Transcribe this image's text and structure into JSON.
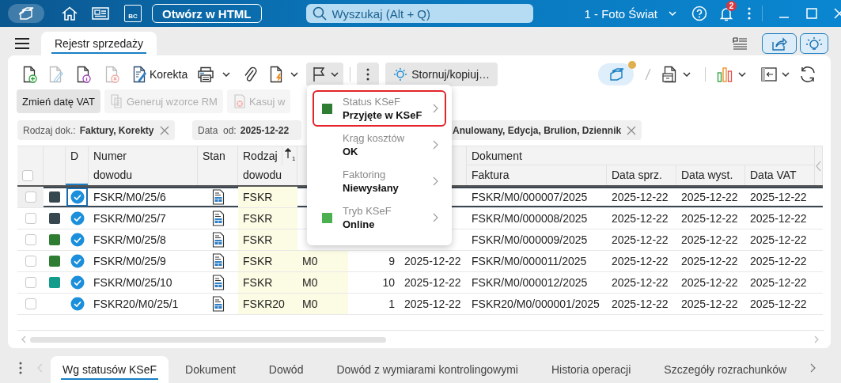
{
  "titlebar": {
    "html_button": "Otwórz w HTML",
    "bc_label": "BC",
    "search": {
      "placeholder": "Wyszukaj (Alt + Q)"
    },
    "company": "1 - Foto Świat",
    "notifications": "2"
  },
  "tabs": [
    {
      "label": "Rejestr sprzedaży",
      "selected": true
    }
  ],
  "toolbar": {
    "correction": "Korekta",
    "flag_menu_open": true,
    "storno": "Stornuj/kopiuj…",
    "sync_pending": true
  },
  "actions": [
    {
      "label": "Zmień datę VAT",
      "disabled": false
    },
    {
      "label": "Generuj wzorce RM",
      "disabled": true
    },
    {
      "label": "Kasuj w",
      "disabled": true
    }
  ],
  "filters": [
    {
      "label": "Rodzaj dok.:",
      "value": "Faktury, Korekty"
    },
    {
      "label": "Data  od:",
      "value": "2025-12-22"
    },
    {
      "value": "Anulowany, Edycja, Brulion, Dziennik"
    }
  ],
  "table": {
    "all_checked": false,
    "header": {
      "d": "D",
      "number": "Numer dowodu",
      "status": "Stan",
      "doc_type": "Rodzaj dowodu",
      "sort_order": "1",
      "group": "Dokument",
      "invoice": "Faktura",
      "sale_date": "Data sprz.",
      "issue_date": "Data wyst.",
      "vat_date": "Data VAT"
    },
    "rows": [
      {
        "checked": false,
        "selected": true,
        "color": "#37474f",
        "confirmed": true,
        "number": "FSKR/M0/25/6",
        "doc_type": "FSKR",
        "invoice": "FSKR/M0/000007/2025",
        "sale_date": "2025-12-22",
        "issue_date": "2025-12-22",
        "vat_date": "2025-12-22"
      },
      {
        "checked": false,
        "selected": false,
        "color": "#37474f",
        "confirmed": true,
        "number": "FSKR/M0/25/7",
        "doc_type": "FSKR",
        "invoice": "FSKR/M0/000008/2025",
        "sale_date": "2025-12-22",
        "issue_date": "2025-12-22",
        "vat_date": "2025-12-22"
      },
      {
        "checked": false,
        "selected": false,
        "color": "#2e7d32",
        "confirmed": true,
        "number": "FSKR/M0/25/8",
        "doc_type": "FSKR",
        "invoice": "FSKR/M0/000009/2025",
        "sale_date": "2025-12-22",
        "issue_date": "2025-12-22",
        "vat_date": "2025-12-22"
      },
      {
        "checked": false,
        "selected": false,
        "color": "#2e7d32",
        "confirmed": true,
        "number": "FSKR/M0/25/9",
        "doc_type": "FSKR",
        "warehouse": "M0",
        "nr": "9",
        "date": "2025-12-22",
        "invoice": "FSKR/M0/000011/2025",
        "sale_date": "2025-12-22",
        "issue_date": "2025-12-22",
        "vat_date": "2025-12-22"
      },
      {
        "checked": false,
        "selected": false,
        "color": "#139b8b",
        "confirmed": true,
        "number": "FSKR/M0/25/10",
        "doc_type": "FSKR",
        "warehouse": "M0",
        "nr": "10",
        "date": "2025-12-22",
        "invoice": "FSKR/M0/000012/2025",
        "sale_date": "2025-12-22",
        "issue_date": "2025-12-22",
        "vat_date": "2025-12-22"
      },
      {
        "checked": false,
        "selected": false,
        "confirmed": true,
        "number": "FSKR20/M0/25/1",
        "doc_type": "FSKR20",
        "warehouse": "M0",
        "nr": "1",
        "date": "2025-12-22",
        "invoice": "FSKR20/M0/000001/2025",
        "sale_date": "2025-12-22",
        "issue_date": "2025-12-22",
        "vat_date": "2025-12-22"
      }
    ]
  },
  "menu": {
    "items": [
      {
        "label": "Status KSeF",
        "value": "Przyjęte w KSeF",
        "color": "#2e7d32",
        "highlighted": true
      },
      {
        "label": "Krąg kosztów",
        "value": "OK",
        "highlighted": false
      },
      {
        "label": "Faktoring",
        "value": "Niewysłany",
        "highlighted": false
      },
      {
        "label": "Tryb KSeF",
        "value": "Online",
        "color": "#4caf50",
        "highlighted": false
      }
    ]
  },
  "bottom_tabs": [
    {
      "label": "Wg statusów KSeF",
      "selected": true
    },
    {
      "label": "Dokument",
      "selected": false
    },
    {
      "label": "Dowód",
      "selected": false
    },
    {
      "label": "Dowód z wymiarami kontrolingowymi",
      "selected": false
    },
    {
      "label": "Historia operacji",
      "selected": false
    },
    {
      "label": "Szczegóły rozrachunków",
      "selected": false
    }
  ]
}
